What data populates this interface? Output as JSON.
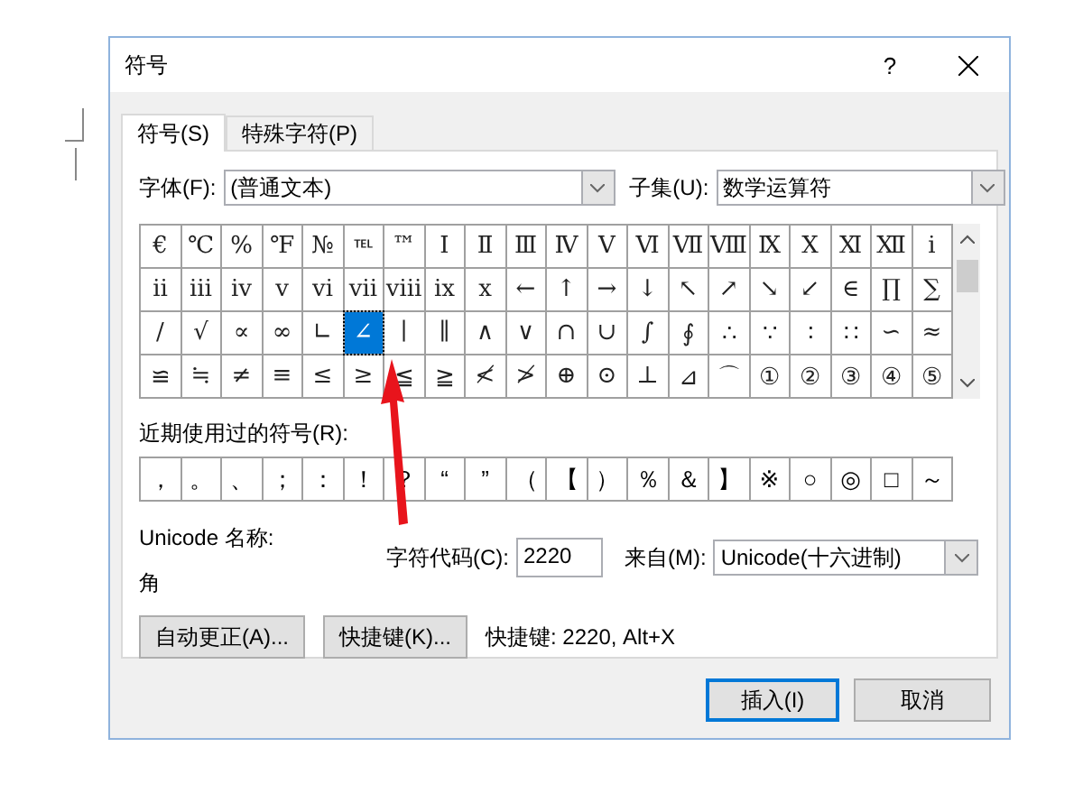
{
  "window": {
    "title": "符号",
    "help": "?"
  },
  "tabs": [
    {
      "label": "符号(S)",
      "selected": true
    },
    {
      "label": "特殊字符(P)",
      "selected": false
    }
  ],
  "font": {
    "label": "字体(F):",
    "value": "(普通文本)"
  },
  "subset": {
    "label": "子集(U):",
    "value": "数学运算符"
  },
  "symbols": [
    [
      {
        "ch": "€",
        "selected": false
      },
      {
        "ch": "℃",
        "selected": false
      },
      {
        "ch": "%",
        "selected": false
      },
      {
        "ch": "℉",
        "selected": false
      },
      {
        "ch": "№",
        "selected": false
      },
      {
        "ch": "℡",
        "selected": false
      },
      {
        "ch": "™",
        "selected": false
      },
      {
        "ch": "Ⅰ",
        "selected": false
      },
      {
        "ch": "Ⅱ",
        "selected": false
      },
      {
        "ch": "Ⅲ",
        "selected": false
      },
      {
        "ch": "Ⅳ",
        "selected": false
      },
      {
        "ch": "Ⅴ",
        "selected": false
      },
      {
        "ch": "Ⅵ",
        "selected": false
      },
      {
        "ch": "Ⅶ",
        "selected": false
      },
      {
        "ch": "Ⅷ",
        "selected": false
      },
      {
        "ch": "Ⅸ",
        "selected": false
      },
      {
        "ch": "Ⅹ",
        "selected": false
      },
      {
        "ch": "Ⅺ",
        "selected": false
      },
      {
        "ch": "Ⅻ",
        "selected": false
      },
      {
        "ch": "ⅰ",
        "selected": false
      }
    ],
    [
      {
        "ch": "ⅱ",
        "selected": false
      },
      {
        "ch": "ⅲ",
        "selected": false
      },
      {
        "ch": "ⅳ",
        "selected": false
      },
      {
        "ch": "ⅴ",
        "selected": false
      },
      {
        "ch": "ⅵ",
        "selected": false
      },
      {
        "ch": "ⅶ",
        "selected": false
      },
      {
        "ch": "ⅷ",
        "selected": false
      },
      {
        "ch": "ⅸ",
        "selected": false
      },
      {
        "ch": "ⅹ",
        "selected": false
      },
      {
        "ch": "←",
        "selected": false
      },
      {
        "ch": "↑",
        "selected": false
      },
      {
        "ch": "→",
        "selected": false
      },
      {
        "ch": "↓",
        "selected": false
      },
      {
        "ch": "↖",
        "selected": false
      },
      {
        "ch": "↗",
        "selected": false
      },
      {
        "ch": "↘",
        "selected": false
      },
      {
        "ch": "↙",
        "selected": false
      },
      {
        "ch": "∈",
        "selected": false
      },
      {
        "ch": "∏",
        "selected": false
      },
      {
        "ch": "∑",
        "selected": false
      }
    ],
    [
      {
        "ch": "∕",
        "selected": false
      },
      {
        "ch": "√",
        "selected": false
      },
      {
        "ch": "∝",
        "selected": false
      },
      {
        "ch": "∞",
        "selected": false
      },
      {
        "ch": "∟",
        "selected": false
      },
      {
        "ch": "∠",
        "selected": true
      },
      {
        "ch": "∣",
        "selected": false
      },
      {
        "ch": "∥",
        "selected": false
      },
      {
        "ch": "∧",
        "selected": false
      },
      {
        "ch": "∨",
        "selected": false
      },
      {
        "ch": "∩",
        "selected": false
      },
      {
        "ch": "∪",
        "selected": false
      },
      {
        "ch": "∫",
        "selected": false
      },
      {
        "ch": "∮",
        "selected": false
      },
      {
        "ch": "∴",
        "selected": false
      },
      {
        "ch": "∵",
        "selected": false
      },
      {
        "ch": "∶",
        "selected": false
      },
      {
        "ch": "∷",
        "selected": false
      },
      {
        "ch": "∽",
        "selected": false
      },
      {
        "ch": "≈",
        "selected": false
      }
    ],
    [
      {
        "ch": "≌",
        "selected": false
      },
      {
        "ch": "≒",
        "selected": false
      },
      {
        "ch": "≠",
        "selected": false
      },
      {
        "ch": "≡",
        "selected": false
      },
      {
        "ch": "≤",
        "selected": false
      },
      {
        "ch": "≥",
        "selected": false
      },
      {
        "ch": "≦",
        "selected": false
      },
      {
        "ch": "≧",
        "selected": false
      },
      {
        "ch": "≮",
        "selected": false
      },
      {
        "ch": "≯",
        "selected": false
      },
      {
        "ch": "⊕",
        "selected": false
      },
      {
        "ch": "⊙",
        "selected": false
      },
      {
        "ch": "⊥",
        "selected": false
      },
      {
        "ch": "⊿",
        "selected": false
      },
      {
        "ch": "⌒",
        "selected": false
      },
      {
        "ch": "①",
        "selected": false
      },
      {
        "ch": "②",
        "selected": false
      },
      {
        "ch": "③",
        "selected": false
      },
      {
        "ch": "④",
        "selected": false
      },
      {
        "ch": "⑤",
        "selected": false
      }
    ]
  ],
  "recent": {
    "label": "近期使用过的符号(R):",
    "items": [
      "，",
      "。",
      "、",
      "；",
      "：",
      "！",
      "？",
      "“",
      "”",
      "（",
      "【",
      "）",
      "％",
      "＆",
      "】",
      "※",
      "○",
      "◎",
      "□",
      "～"
    ]
  },
  "unicode_name": {
    "label": "Unicode 名称:",
    "value": "角"
  },
  "char_code": {
    "label": "字符代码(C):",
    "value": "2220"
  },
  "from": {
    "label": "来自(M):",
    "value": "Unicode(十六进制)"
  },
  "actions": [
    "自动更正(A)...",
    "快捷键(K)..."
  ],
  "shortcut": "快捷键: 2220, Alt+X",
  "footer": [
    {
      "label": "插入(I)",
      "default": true
    },
    {
      "label": "取消",
      "default": false
    }
  ]
}
